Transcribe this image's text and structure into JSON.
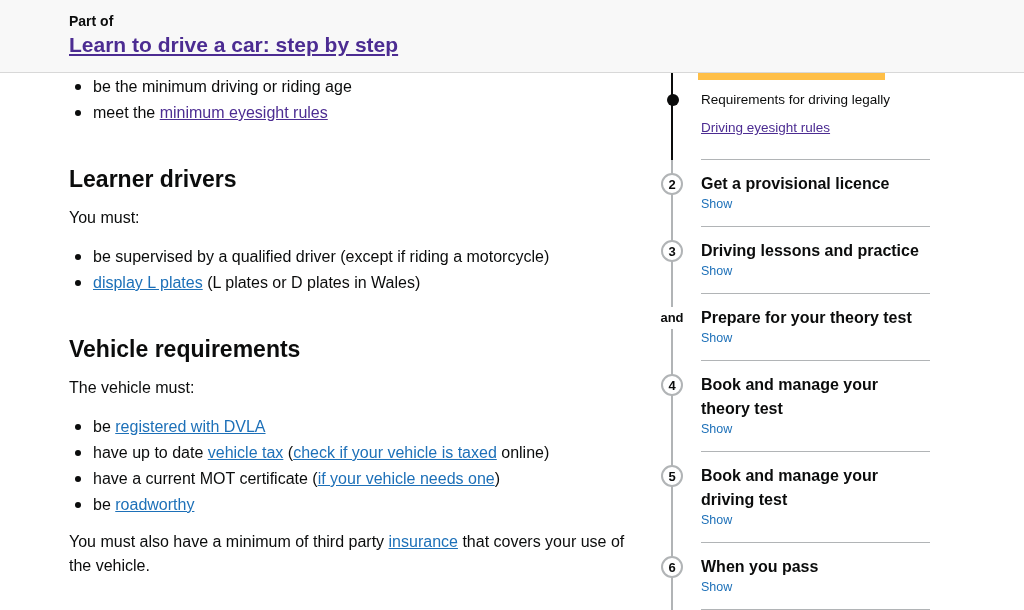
{
  "header": {
    "label": "Part of",
    "link": "Learn to drive a car: step by step"
  },
  "content": [
    {
      "kind": "list",
      "items": [
        [
          {
            "kind": "text",
            "text": "be the minimum driving or riding age"
          }
        ],
        [
          {
            "kind": "text",
            "text": "meet the "
          },
          {
            "kind": "visited",
            "text": "minimum eyesight rules"
          }
        ]
      ]
    },
    {
      "kind": "heading",
      "text": "Learner drivers"
    },
    {
      "kind": "paragraph",
      "parts": [
        {
          "kind": "text",
          "text": "You must:"
        }
      ]
    },
    {
      "kind": "list",
      "items": [
        [
          {
            "kind": "text",
            "text": "be supervised by a qualified driver (except if riding a motorcycle)"
          }
        ],
        [
          {
            "kind": "link",
            "text": "display L plates"
          },
          {
            "kind": "text",
            "text": " (L plates or D plates in Wales)"
          }
        ]
      ]
    },
    {
      "kind": "heading",
      "text": "Vehicle requirements"
    },
    {
      "kind": "paragraph",
      "parts": [
        {
          "kind": "text",
          "text": "The vehicle must:"
        }
      ]
    },
    {
      "kind": "list",
      "items": [
        [
          {
            "kind": "text",
            "text": "be "
          },
          {
            "kind": "link",
            "text": "registered with DVLA"
          }
        ],
        [
          {
            "kind": "text",
            "text": "have up to date "
          },
          {
            "kind": "link",
            "text": "vehicle tax"
          },
          {
            "kind": "text",
            "text": " ("
          },
          {
            "kind": "link",
            "text": "check if your vehicle is taxed"
          },
          {
            "kind": "text",
            "text": " online)"
          }
        ],
        [
          {
            "kind": "text",
            "text": "have a current MOT certificate ("
          },
          {
            "kind": "link",
            "text": "if your vehicle needs one"
          },
          {
            "kind": "text",
            "text": ")"
          }
        ],
        [
          {
            "kind": "text",
            "text": "be "
          },
          {
            "kind": "link",
            "text": "roadworthy"
          }
        ]
      ]
    },
    {
      "kind": "paragraph",
      "parts": [
        {
          "kind": "text",
          "text": "You must also have a minimum of third party "
        },
        {
          "kind": "link",
          "text": "insurance"
        },
        {
          "kind": "text",
          "text": " that covers your use of the vehicle."
        }
      ]
    }
  ],
  "step_nav": {
    "current": {
      "heading": "Requirements for driving legally",
      "link": "Driving eyesight rules"
    },
    "steps": [
      {
        "kind": "number",
        "marker": "2",
        "title": "Get a provisional licence",
        "toggle": "Show"
      },
      {
        "kind": "number",
        "marker": "3",
        "title": "Driving lessons and practice",
        "toggle": "Show"
      },
      {
        "kind": "and",
        "marker": "and",
        "title": "Prepare for your theory test",
        "toggle": "Show"
      },
      {
        "kind": "number",
        "marker": "4",
        "title": "Book and manage your theory test",
        "toggle": "Show"
      },
      {
        "kind": "number",
        "marker": "5",
        "title": "Book and manage your driving test",
        "toggle": "Show"
      },
      {
        "kind": "number",
        "marker": "6",
        "title": "When you pass",
        "toggle": "Show"
      }
    ]
  }
}
